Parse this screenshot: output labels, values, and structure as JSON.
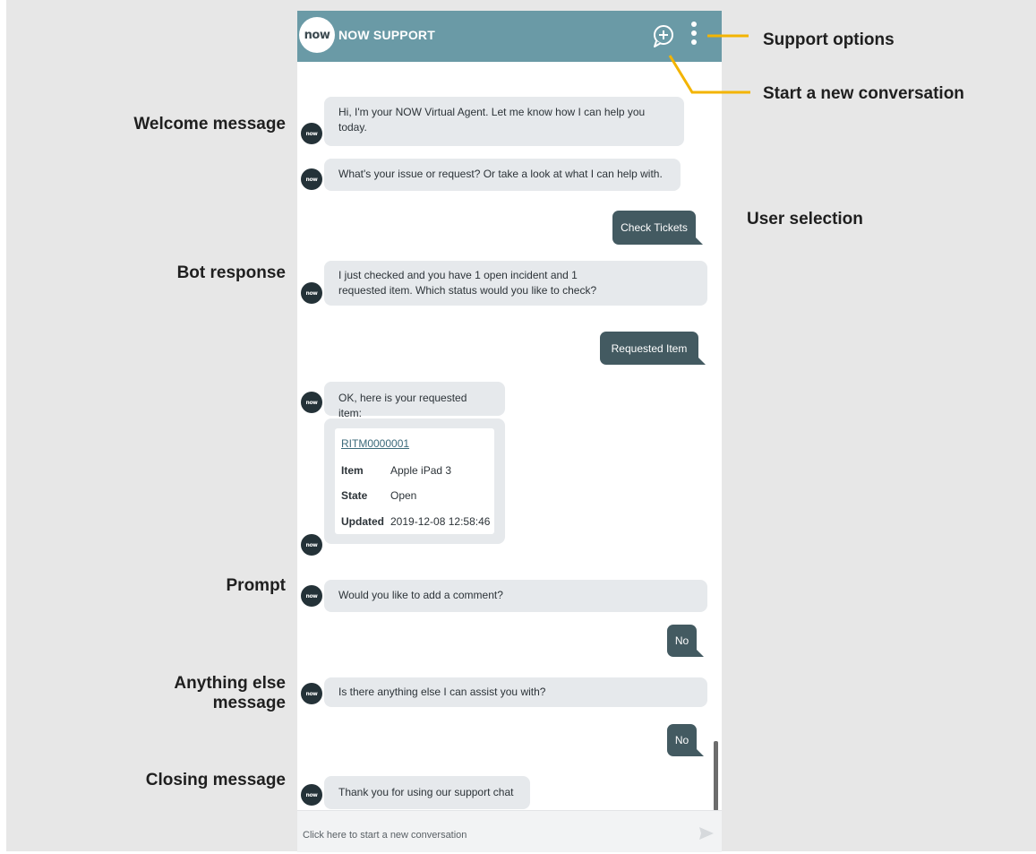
{
  "header": {
    "logo_text": "now",
    "title": "NOW SUPPORT",
    "new_conversation_icon": "chat-plus-icon",
    "options_icon": "vertical-dots-icon"
  },
  "colors": {
    "header": "#6a9aa6",
    "bot_bubble": "#e6e9ec",
    "user_bubble": "#435a61",
    "avatar": "#243238",
    "annotation_line": "#f3b400"
  },
  "avatar_text": "now",
  "messages": {
    "welcome_line1": "Hi, I'm your NOW Virtual Agent. Let me know how I can help you",
    "welcome_line2": "today.",
    "issue": "What's your issue or request? Or take a look at what I can help with.",
    "user_check_tickets": "Check Tickets",
    "bot_response_line1": "I just checked and you have 1 open incident and 1",
    "bot_response_line2": "requested item.  Which status would you like to check?",
    "user_requested_item": "Requested Item",
    "ok_here": "OK, here is your requested item:",
    "prompt": "Would you like to add a comment?",
    "user_no_1": "No",
    "anything_else": "Is there anything else I can assist you with?",
    "user_no_2": "No",
    "closing": "Thank you for using our support chat"
  },
  "card": {
    "number": "RITM0000001",
    "rows": [
      {
        "key": "Item",
        "value": "Apple iPad 3"
      },
      {
        "key": "State",
        "value": "Open"
      },
      {
        "key": "Updated",
        "value": "2019-12-08 12:58:46"
      }
    ]
  },
  "input": {
    "placeholder": "Click here to start a new conversation",
    "send_icon": "send-arrow-icon"
  },
  "annotations": {
    "support_options": "Support options",
    "start_new_conversation": "Start a new conversation",
    "welcome_message": "Welcome message",
    "user_selection": "User selection",
    "bot_response": "Bot response",
    "prompt": "Prompt",
    "anything_else_line1": "Anything else",
    "anything_else_line2": "message",
    "closing_message": "Closing message"
  }
}
